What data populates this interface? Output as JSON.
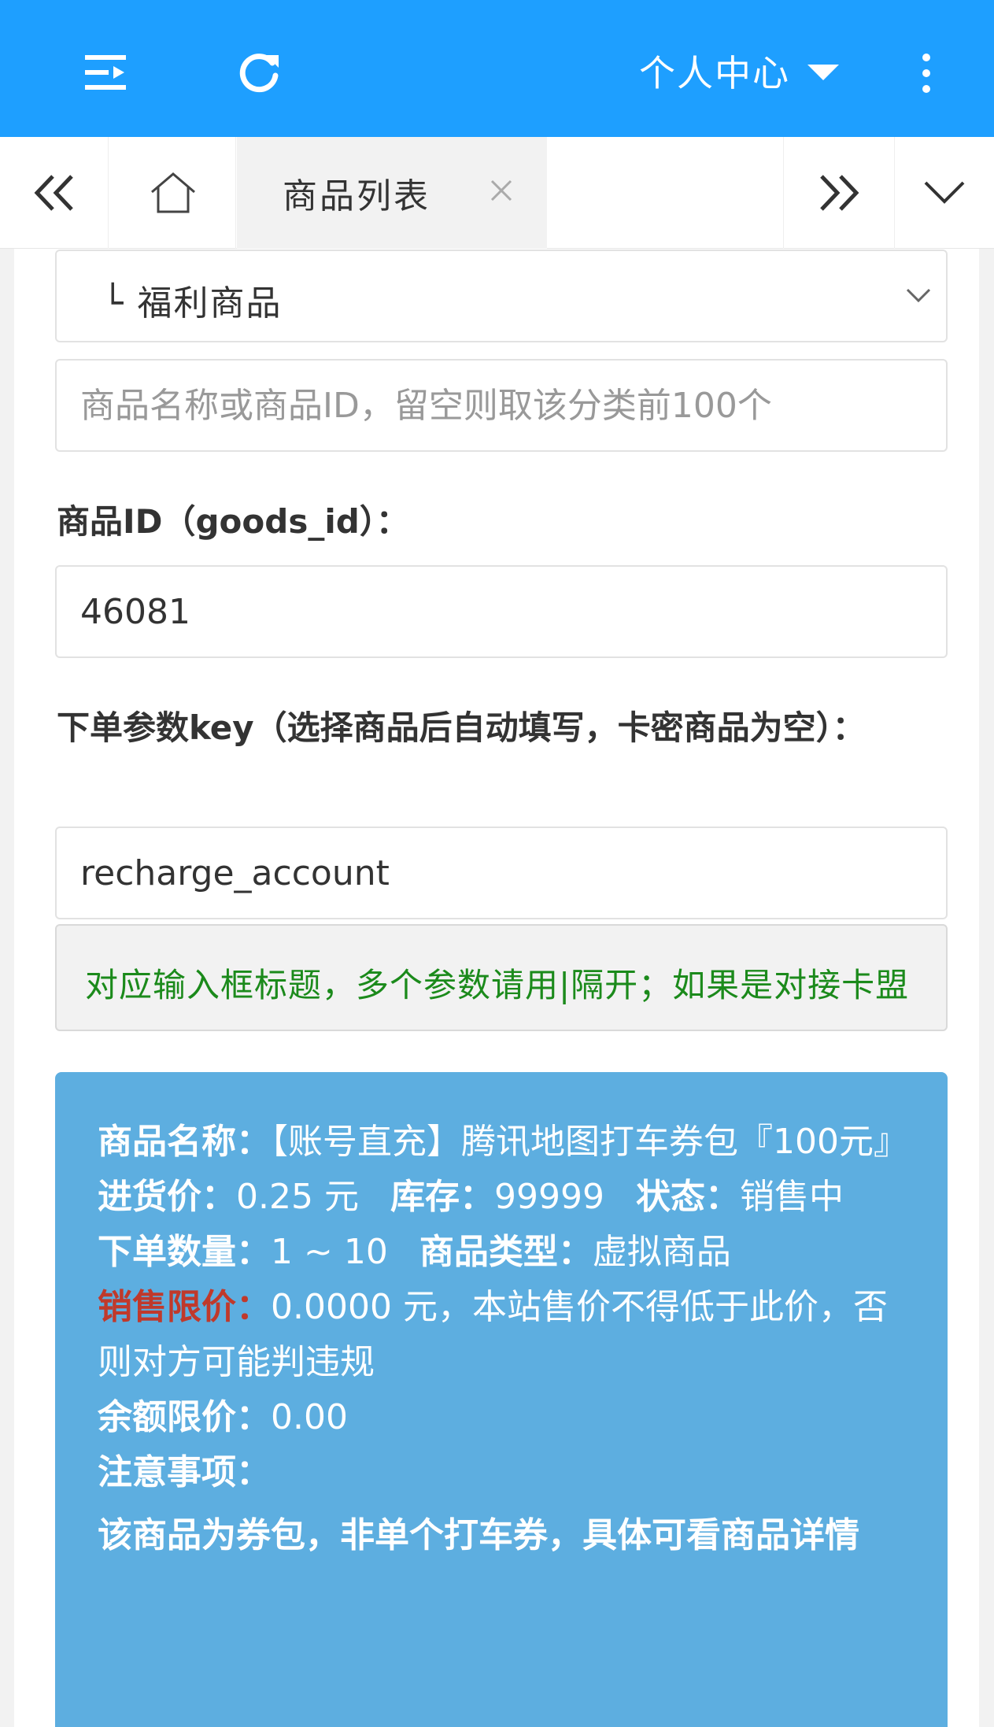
{
  "topbar": {
    "user_menu_label": "个人中心",
    "icons": [
      "menu-fold-icon",
      "refresh-icon",
      "caret-down-icon",
      "more-vertical-icon"
    ]
  },
  "tabs": {
    "active_label": "商品列表",
    "icons": [
      "double-chevron-left-icon",
      "home-icon",
      "close-icon",
      "double-chevron-right-icon",
      "chevron-down-icon"
    ]
  },
  "form": {
    "category_select_value": "└ 福利商品",
    "search_placeholder": "商品名称或商品ID，留空则取该分类前100个",
    "goods_id_label": "商品ID（goods_id）：",
    "goods_id_value": "46081",
    "key_label": "下单参数key（选择商品后自动填写，卡密商品为空）：",
    "key_value": "recharge_account",
    "key_hint": "对应输入框标题，多个参数请用|隔开；如果是对接卡盟"
  },
  "info": {
    "name_label": "商品名称：",
    "name_value": "【账号直充】腾讯地图打车券包『100元』",
    "price_label": "进货价：",
    "price_value": "0.25 元",
    "stock_label": "库存：",
    "stock_value": "99999",
    "status_label": "状态：",
    "status_value": "销售中",
    "qty_label": "下单数量：",
    "qty_value": "1 ~ 10",
    "type_label": "商品类型：",
    "type_value": "虚拟商品",
    "limit_label": "销售限价：",
    "limit_value": "0.0000 元，本站售价不得低于此价，否则对方可能判违规",
    "balance_label": "余额限价：",
    "balance_value": "0.00",
    "notes_label": "注意事项：",
    "notes_value": "该商品为券包，非单个打车券，具体可看商品详情"
  },
  "colors": {
    "topbar": "#1e9fff",
    "info_bg": "#5daee0",
    "hint_text": "#1b8a1b",
    "warn_label": "#c0392b"
  }
}
